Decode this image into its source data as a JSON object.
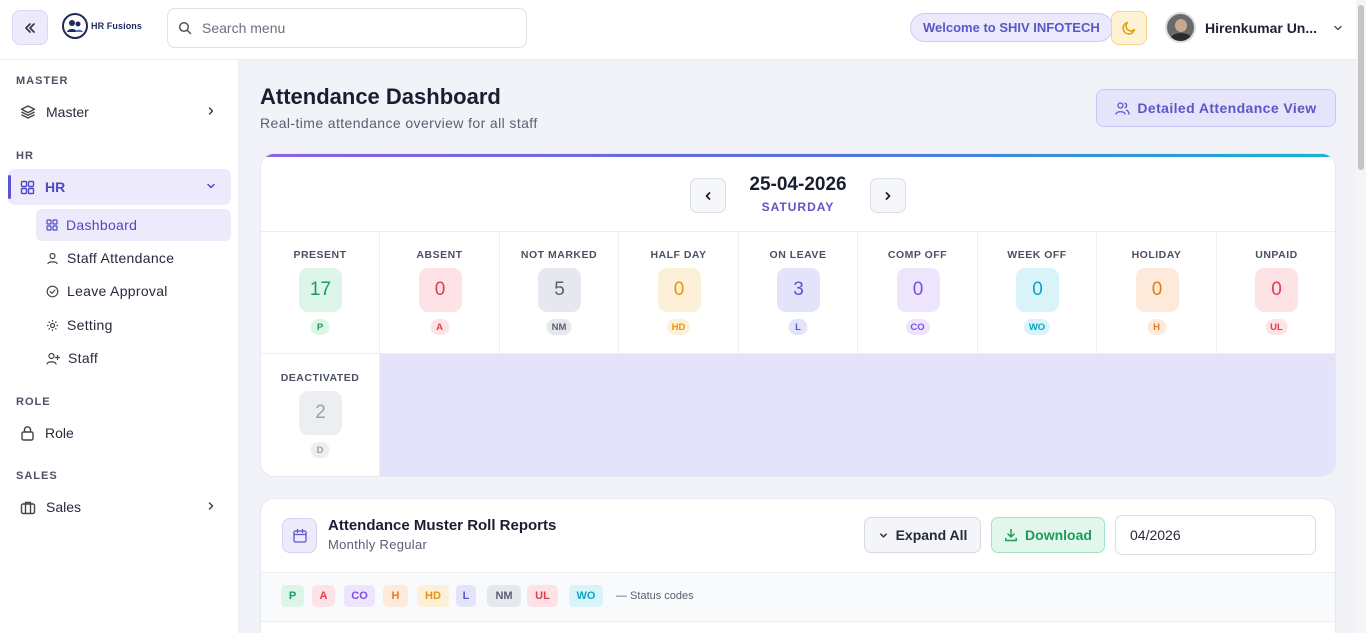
{
  "topbar": {
    "brand": "HR Fusions",
    "search_placeholder": "Search menu",
    "welcome": "Welcome to SHIV INFOTECH",
    "user_name": "Hirenkumar Un..."
  },
  "sidebar": {
    "sections": {
      "master": "MASTER",
      "hr": "HR",
      "role": "ROLE",
      "sales": "SALES"
    },
    "items": {
      "master": "Master",
      "hr": "HR",
      "role": "Role",
      "sales": "Sales"
    },
    "hr_sub": {
      "dashboard": "Dashboard",
      "staff_attendance": "Staff Attendance",
      "leave_approval": "Leave Approval",
      "setting": "Setting",
      "staff": "Staff"
    }
  },
  "page": {
    "title": "Attendance Dashboard",
    "subtitle": "Real-time attendance overview for all staff",
    "detail_button": "Detailed Attendance View"
  },
  "date_nav": {
    "date": "25-04-2026",
    "day": "SATURDAY"
  },
  "stats": [
    {
      "label": "PRESENT",
      "value": "17",
      "code": "P",
      "color": "#1e9a5c",
      "bg": "#dcf5e8"
    },
    {
      "label": "ABSENT",
      "value": "0",
      "code": "A",
      "color": "#e03e4e",
      "bg": "#fde3e6"
    },
    {
      "label": "NOT MARKED",
      "value": "5",
      "code": "NM",
      "color": "#5a6072",
      "bg": "#e6e8ee"
    },
    {
      "label": "HALF DAY",
      "value": "0",
      "code": "HD",
      "color": "#e8930c",
      "bg": "#fdf0d9"
    },
    {
      "label": "ON LEAVE",
      "value": "3",
      "code": "L",
      "color": "#5458d8",
      "bg": "#e3e3fa"
    },
    {
      "label": "COMP OFF",
      "value": "0",
      "code": "CO",
      "color": "#7d4ee0",
      "bg": "#ece5fb"
    },
    {
      "label": "WEEK OFF",
      "value": "0",
      "code": "WO",
      "color": "#0aa5c2",
      "bg": "#d9f4f8"
    },
    {
      "label": "HOLIDAY",
      "value": "0",
      "code": "H",
      "color": "#ea7a1e",
      "bg": "#fdeadb"
    },
    {
      "label": "UNPAID",
      "value": "0",
      "code": "UL",
      "color": "#e03e4e",
      "bg": "#fde3e6"
    },
    {
      "label": "DEACTIVATED",
      "value": "2",
      "code": "D",
      "color": "#9ba0ad",
      "bg": "#eceef2"
    }
  ],
  "muster": {
    "title": "Attendance Muster Roll Reports",
    "subtitle": "Monthly Regular",
    "expand_label": "Expand All",
    "download_label": "Download",
    "month_value": "04/2026",
    "codes": [
      {
        "code": "P",
        "color": "#1e9a5c",
        "bg": "#dcf5e8"
      },
      {
        "code": "A",
        "color": "#e03e4e",
        "bg": "#fde3e6"
      },
      {
        "code": "CO",
        "color": "#7d4ee0",
        "bg": "#ece5fb"
      },
      {
        "code": "H",
        "color": "#ea7a1e",
        "bg": "#fdeadb"
      },
      {
        "code": "HD",
        "color": "#e8930c",
        "bg": "#fdf0d9"
      },
      {
        "code": "L",
        "color": "#5458d8",
        "bg": "#e3e3fa"
      },
      {
        "code": "NM",
        "color": "#5a6072",
        "bg": "#e6e8ee"
      },
      {
        "code": "UL",
        "color": "#e03e4e",
        "bg": "#fde3e6"
      },
      {
        "code": "WO",
        "color": "#0aa5c2",
        "bg": "#d9f4f8"
      }
    ],
    "codes_note": "— Status codes"
  }
}
